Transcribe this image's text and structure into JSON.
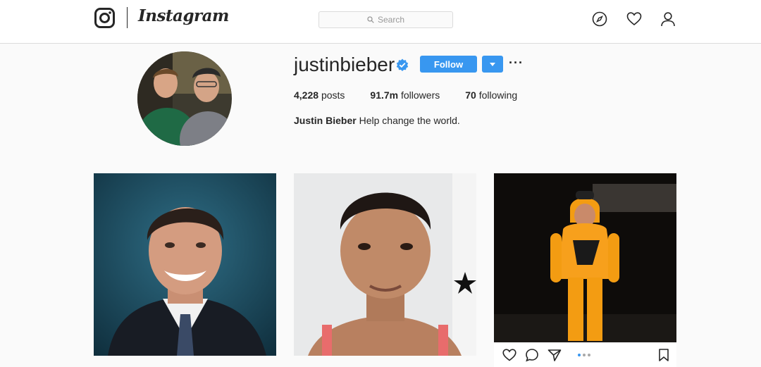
{
  "nav": {
    "wordmark": "Instagram",
    "search_placeholder": "Search",
    "icons": [
      "instagram-glyph-icon",
      "explore-compass-icon",
      "heart-icon",
      "profile-person-icon"
    ]
  },
  "profile": {
    "username": "justinbieber",
    "verified": true,
    "follow_label": "Follow",
    "more_label": "···",
    "stats": {
      "posts_count": "4,228",
      "posts_label": "posts",
      "followers_count": "91.7m",
      "followers_label": "followers",
      "following_count": "70",
      "following_label": "following"
    },
    "bio": {
      "full_name": "Justin Bieber",
      "text": "Help change the world."
    }
  },
  "posts": [
    {
      "name": "post-portrait-suit"
    },
    {
      "name": "post-portrait-young-man"
    },
    {
      "name": "post-orange-hoodie-night"
    }
  ],
  "colors": {
    "accent": "#3897f0",
    "text": "#262626",
    "background": "#fafafa",
    "border": "#dbdbdb"
  },
  "carousel": {
    "total": 3,
    "active": 1
  }
}
